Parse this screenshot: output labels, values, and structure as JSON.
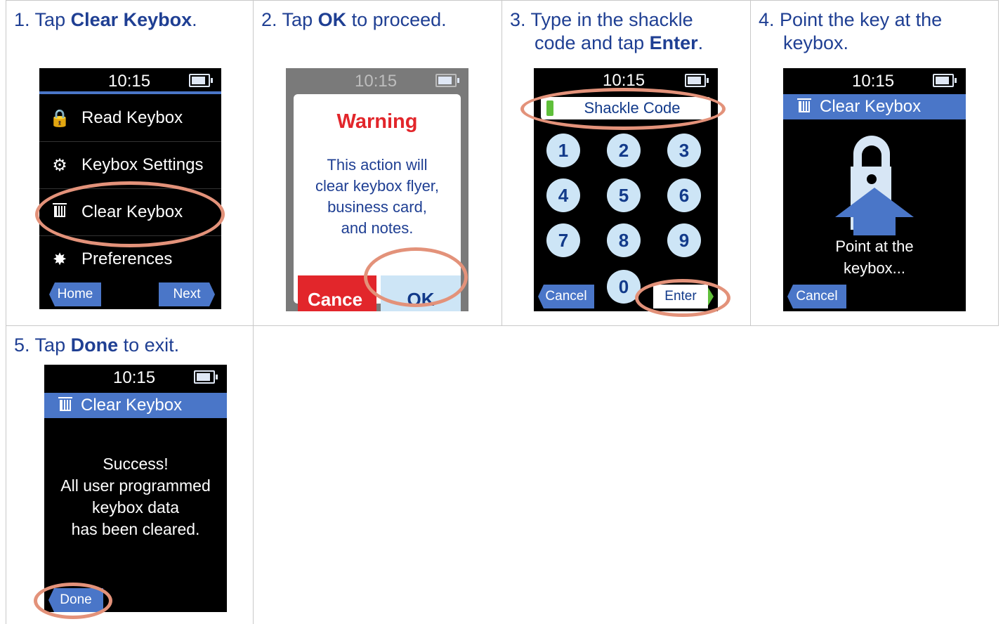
{
  "steps": [
    {
      "number": "1.",
      "pre": "Tap ",
      "bold": "Clear Keybox",
      "post": "."
    },
    {
      "number": "2.",
      "pre": "Tap ",
      "bold": "OK",
      "post": " to proceed."
    },
    {
      "number": "3.",
      "line1": "Type in the shackle",
      "line2_pre": "code and tap ",
      "bold": "Enter",
      "post": "."
    },
    {
      "number": "4.",
      "line1": "Point the key at the",
      "line2": "keybox."
    },
    {
      "number": "5.",
      "pre": "Tap ",
      "bold": "Done",
      "post": " to exit."
    }
  ],
  "device": {
    "time": "10:15",
    "menu": {
      "items": [
        "Read Keybox",
        "Keybox Settings",
        "Clear Keybox",
        "Preferences"
      ],
      "left_softkey": "Home",
      "right_softkey": "Next"
    },
    "warning": {
      "title": "Warning",
      "lines": [
        "This action will",
        "clear keybox flyer,",
        "business card,",
        "and notes."
      ],
      "cancel": "Cance",
      "ok": "OK"
    },
    "shackle": {
      "label": "Shackle Code",
      "keys": [
        "1",
        "2",
        "3",
        "4",
        "5",
        "6",
        "7",
        "8",
        "9",
        "0"
      ],
      "cancel": "Cancel",
      "enter": "Enter"
    },
    "point": {
      "title": "Clear Keybox",
      "lines": [
        "Point at the",
        "keybox..."
      ],
      "cancel": "Cancel"
    },
    "success": {
      "title": "Clear Keybox",
      "lines": [
        "Success!",
        "All user programmed",
        "keybox data",
        "has been cleared."
      ],
      "done": "Done"
    }
  },
  "colors": {
    "step_text": "#1f3f93",
    "accent_blue": "#4a76c8",
    "highlight": "#e3927a",
    "warning_red": "#e2262b",
    "keypad": "#cde5f6"
  }
}
